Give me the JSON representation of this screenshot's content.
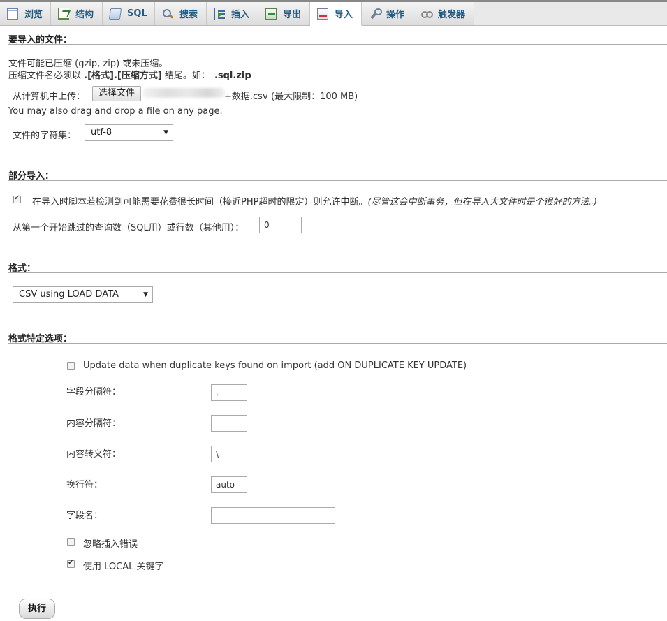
{
  "tabs": [
    {
      "label": "浏览",
      "icon": "browse-icon"
    },
    {
      "label": "结构",
      "icon": "structure-icon"
    },
    {
      "label": "SQL",
      "icon": "sql-icon"
    },
    {
      "label": "搜索",
      "icon": "search-icon"
    },
    {
      "label": "插入",
      "icon": "insert-icon"
    },
    {
      "label": "导出",
      "icon": "export-icon"
    },
    {
      "label": "导入",
      "icon": "import-icon",
      "active": true
    },
    {
      "label": "操作",
      "icon": "operations-icon"
    },
    {
      "label": "触发器",
      "icon": "triggers-icon"
    }
  ],
  "import_file": {
    "title": "要导入的文件：",
    "line1": "文件可能已压缩 (gzip, zip) 或未压缩。",
    "line2_prefix": "压缩文件名必须以 ",
    "line2_format": ".[格式].[压缩方式]",
    "line2_mid": " 结尾。如：",
    "line2_example": ".sql.zip",
    "upload_label": "从计算机中上传：",
    "choose_file_button": "选择文件",
    "file_name_suffix": "+数据.csv",
    "max_limit": "(最大限制：100 MB)",
    "drag_drop_hint": "You may also drag and drop a file on any page.",
    "charset_label": "文件的字符集：",
    "charset_value": "utf-8"
  },
  "partial_import": {
    "title": "部分导入：",
    "allow_interrupt_label": "在导入时脚本若检测到可能需要花费很长时间（接近PHP超时的限定）则允许中断。",
    "allow_interrupt_note": "(尽管这会中断事务，但在导入大文件时是个很好的方法。)",
    "allow_interrupt_checked": true,
    "skip_label": "从第一个开始跳过的查询数（SQL用）或行数（其他用）：",
    "skip_value": "0"
  },
  "format": {
    "title": "格式：",
    "value": "CSV using LOAD DATA"
  },
  "format_options": {
    "title": "格式特定选项：",
    "update_duplicate_label": "Update data when duplicate keys found on import (add ON DUPLICATE KEY UPDATE)",
    "update_duplicate_checked": false,
    "field_sep_label": "字段分隔符：",
    "field_sep_value": ",",
    "content_sep_label": "内容分隔符：",
    "content_sep_value": "",
    "escape_label": "内容转义符：",
    "escape_value": "\\",
    "line_term_label": "换行符：",
    "line_term_value": "auto",
    "column_names_label": "字段名：",
    "column_names_value": "",
    "ignore_errors_label": "忽略插入错误",
    "ignore_errors_checked": false,
    "use_local_label": "使用 LOCAL 关键字",
    "use_local_checked": true
  },
  "execute_button": "执行"
}
